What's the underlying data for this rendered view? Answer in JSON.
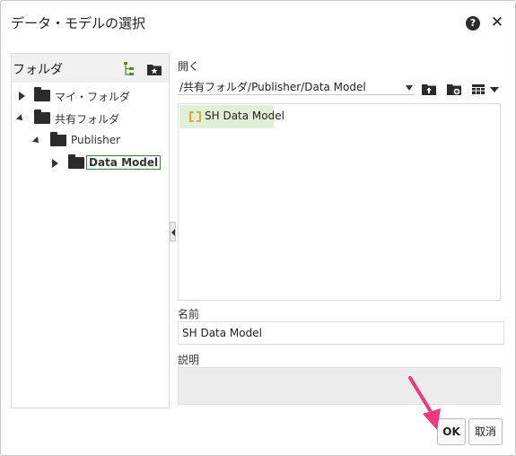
{
  "dialog": {
    "title": "データ・モデルの選択",
    "help_icon": "?",
    "close_icon": "✕"
  },
  "left_panel": {
    "title": "フォルダ",
    "icons": [
      "tree-expand-icon",
      "favorites-folder-icon"
    ],
    "tree": [
      {
        "label": "マイ・フォルダ",
        "expanded": false
      },
      {
        "label": "共有フォルダ",
        "expanded": true
      },
      {
        "label": "Publisher",
        "expanded": true
      },
      {
        "label": "Data Model",
        "expanded": false,
        "selected": true
      }
    ]
  },
  "main": {
    "open_label": "開く",
    "path": "/共有フォルダ/Publisher/Data Model",
    "toolbar_icons": [
      "upload-icon",
      "new-folder-icon",
      "view-grid-icon",
      "dropdown-icon"
    ],
    "items": [
      {
        "label": "SH Data Model",
        "icon": "data-model-icon"
      }
    ],
    "name_label": "名前",
    "name_value": "SH Data Model",
    "description_label": "説明",
    "description_value": ""
  },
  "buttons": {
    "ok": "OK",
    "cancel": "取消"
  },
  "colors": {
    "selected_item_bg": "#dff0d8",
    "pointer": "#f0397a"
  }
}
